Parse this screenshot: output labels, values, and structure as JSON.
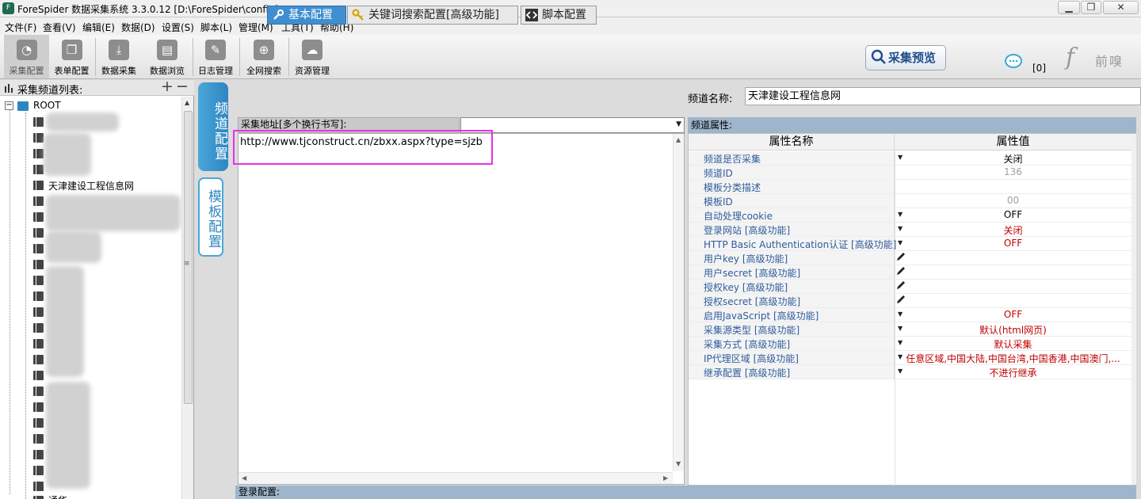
{
  "window": {
    "title": "ForeSpider 数据采集系统  3.3.0.12  [D:\\ForeSpider\\config]",
    "app_icon": "F"
  },
  "menu": [
    "文件(F)",
    "查看(V)",
    "编辑(E)",
    "数据(D)",
    "设置(S)",
    "脚本(L)",
    "管理(M)",
    "工具(T)",
    "帮助(H)"
  ],
  "toolbar": {
    "items": [
      {
        "label": "采集配置",
        "icon": "pie-chart-icon",
        "active": true
      },
      {
        "label": "表单配置",
        "icon": "documents-icon",
        "active": false
      },
      {
        "label": "数据采集",
        "icon": "download-icon",
        "active": false
      },
      {
        "label": "数据浏览",
        "icon": "film-icon",
        "active": false
      },
      {
        "label": "日志管理",
        "icon": "edit-icon",
        "active": false
      },
      {
        "label": "全网搜索",
        "icon": "globe-search-icon",
        "active": false
      },
      {
        "label": "资源管理",
        "icon": "cloud-icon",
        "active": false
      }
    ],
    "preview_label": "采集预览",
    "badge": "[0]",
    "logo_mark": "f",
    "logo_text": "前嗅"
  },
  "left_panel": {
    "title": "采集频道列表:",
    "root": "ROOT",
    "selected_channel": "天津建设工程信息网",
    "last_visible": "通华"
  },
  "vertical_tabs": {
    "channel": "频道配置",
    "template": "模板配置"
  },
  "center": {
    "tabs": [
      "基本配置",
      "关键词搜索配置[高级功能]",
      "脚本配置"
    ],
    "url_label": "采集地址[多个换行书写]:",
    "url_value": "http://www.tjconstruct.cn/zbxx.aspx?type=sjzb",
    "login_label": "登录配置:"
  },
  "right_panel": {
    "channel_name_label": "频道名称:",
    "channel_name_value": "天津建设工程信息网",
    "props_header": "频道属性:",
    "col_name": "属性名称",
    "col_value": "属性值",
    "rows": [
      {
        "name": "频道是否采集",
        "value": "关闭",
        "control": "dropdown",
        "value_color": "#000000"
      },
      {
        "name": "频道ID",
        "value": "136",
        "control": "none",
        "value_color": "#a0a0a0"
      },
      {
        "name": "模板分类描述",
        "value": "",
        "control": "none",
        "value_color": "#000000"
      },
      {
        "name": "模板ID",
        "value": "00",
        "control": "none",
        "value_color": "#a0a0a0"
      },
      {
        "name": "自动处理cookie",
        "value": "OFF",
        "control": "dropdown",
        "value_color": "#000000"
      },
      {
        "name": "登录网站 [高级功能]",
        "value": "关闭",
        "control": "dropdown",
        "value_color": "#c00000"
      },
      {
        "name": "HTTP Basic Authentication认证 [高级功能]",
        "value": "OFF",
        "control": "dropdown",
        "value_color": "#c00000"
      },
      {
        "name": "用户key [高级功能]",
        "value": "",
        "control": "pencil",
        "value_color": "#000000"
      },
      {
        "name": "用户secret [高级功能]",
        "value": "",
        "control": "pencil",
        "value_color": "#000000"
      },
      {
        "name": "授权key [高级功能]",
        "value": "",
        "control": "pencil",
        "value_color": "#000000"
      },
      {
        "name": "授权secret [高级功能]",
        "value": "",
        "control": "pencil",
        "value_color": "#000000"
      },
      {
        "name": "启用JavaScript [高级功能]",
        "value": "OFF",
        "control": "dropdown",
        "value_color": "#c00000"
      },
      {
        "name": "采集源类型 [高级功能]",
        "value": "默认(html网页)",
        "control": "dropdown",
        "value_color": "#c00000"
      },
      {
        "name": "采集方式 [高级功能]",
        "value": "默认采集",
        "control": "dropdown",
        "value_color": "#c00000"
      },
      {
        "name": "IP代理区域 [高级功能]",
        "value": "任意区域,中国大陆,中国台湾,中国香港,中国澳门,...",
        "control": "dropdown",
        "value_color": "#c00000"
      },
      {
        "name": "继承配置 [高级功能]",
        "value": "不进行继承",
        "control": "dropdown",
        "value_color": "#c00000"
      }
    ]
  },
  "colors": {
    "accent_blue": "#3f8ed0",
    "header_band": "#9fb5cc",
    "highlight_box": "#e830e8",
    "advanced_value": "#c00000",
    "property_name": "#2f5c9c"
  }
}
